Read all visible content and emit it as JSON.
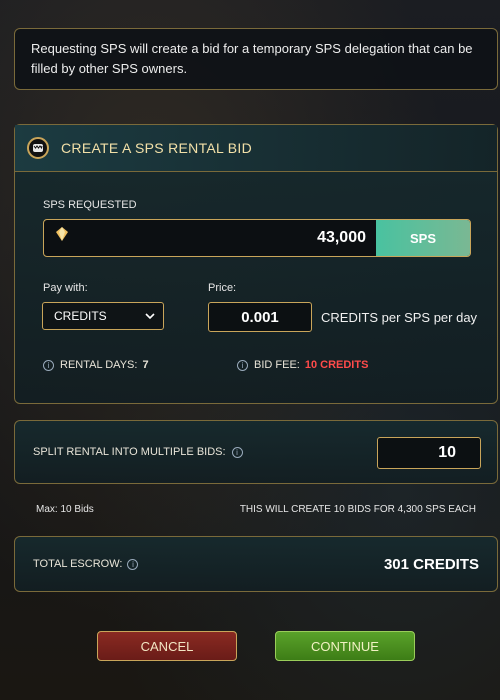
{
  "info": {
    "text": "Requesting SPS will create a bid for a temporary SPS delegation that can be filled by other SPS owners."
  },
  "main": {
    "title": "CREATE A SPS RENTAL BID",
    "sps_requested_label": "SPS REQUESTED",
    "sps_amount": "43,000",
    "sps_unit": "SPS",
    "pay_with_label": "Pay with:",
    "pay_with_value": "CREDITS",
    "price_label": "Price:",
    "price_value": "0.001",
    "price_unit": "CREDITS per SPS per day",
    "rental_days_label": "RENTAL DAYS:",
    "rental_days_value": "7",
    "bid_fee_label": "BID FEE:",
    "bid_fee_value": "10 CREDITS"
  },
  "split": {
    "label": "SPLIT RENTAL INTO MULTIPLE BIDS:",
    "value": "10",
    "max_text": "Max: 10 Bids",
    "summary_text": "THIS WILL CREATE 10 BIDS FOR 4,300 SPS EACH"
  },
  "escrow": {
    "label": "TOTAL ESCROW:",
    "value": "301 CREDITS"
  },
  "buttons": {
    "cancel": "CANCEL",
    "continue": "CONTINUE"
  },
  "icons": {
    "header": "monster-mouth-icon",
    "sps": "sps-crystal-icon",
    "info": "info-icon",
    "dropdown": "chevron-down-icon"
  },
  "colors": {
    "accent_gold": "#c9a55a",
    "bid_fee_red": "#ff4b4b",
    "sps_teal": "#49c2a0",
    "cancel_red": "#8a2a22",
    "continue_green": "#5aa22a"
  }
}
